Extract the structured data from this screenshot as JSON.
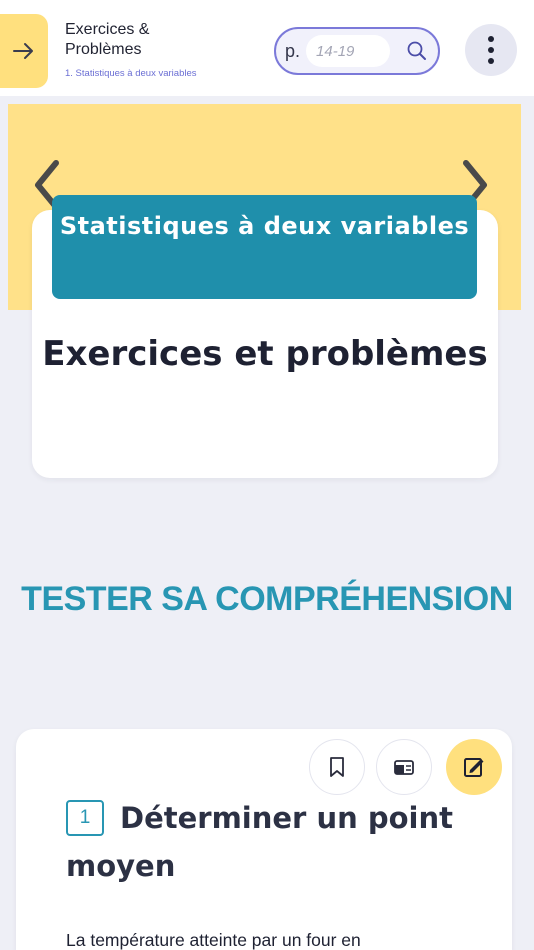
{
  "header": {
    "title_line1": "Exercices &",
    "title_line2": "Problèmes",
    "subtitle": "1. Statistiques à deux variables",
    "page_prefix": "p.",
    "page_placeholder": "14-19"
  },
  "banner": {
    "chapter": "Statistiques à deux variables",
    "card_title": "Exercices et problèmes"
  },
  "section": {
    "heading": "TESTER SA COMPRÉHENSION"
  },
  "exercise": {
    "number": "1",
    "title": "Déterminer un point moyen",
    "body": "La température atteinte par un four en"
  },
  "colors": {
    "accent_yellow": "#ffe07e",
    "accent_teal": "#1f8fab",
    "accent_purple": "#7b79d9"
  },
  "icons": {
    "back": "arrow-right-icon",
    "search": "magnifier-icon",
    "menu": "vertical-dots-icon",
    "prev": "chevron-left-icon",
    "next": "chevron-right-icon",
    "bookmark": "bookmark-icon",
    "card": "flashcard-icon",
    "edit": "edit-note-icon"
  }
}
